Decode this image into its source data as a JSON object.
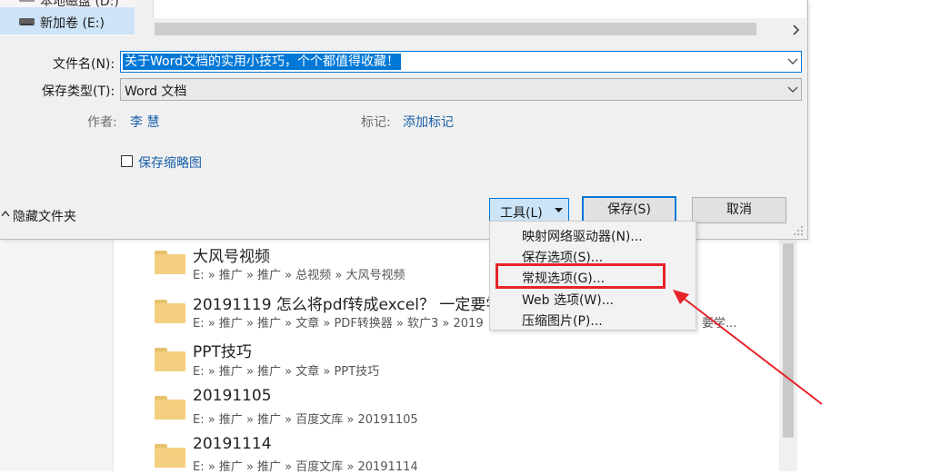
{
  "background": {
    "results": [
      {
        "title": "大风号视频",
        "path": "E: » 推广 » 推广 » 总视频 » 大风号视频"
      },
      {
        "title": "20191119 怎么将pdf转成excel？ 一定要学",
        "path": "E: » 推广 » 推广 » 文章 » PDF转换器 » 软广3 » 2019",
        "path_tail": "要学..."
      },
      {
        "title": "PPT技巧",
        "path": "E: » 推广 » 推广 » 文章 » PPT技巧"
      },
      {
        "title": "20191105",
        "path": "E: » 推广 » 推广 » 百度文库 » 20191105"
      },
      {
        "title": "20191114",
        "path": "E: » 推广 » 推广 » 百度文库 » 20191114"
      }
    ]
  },
  "dialog": {
    "nav": {
      "partial_item": "本地磁盘 (D:)",
      "selected_item": "新加卷 (E:)"
    },
    "filename_label": "文件名(N):",
    "filename_value": "关于Word文档的实用小技巧，个个都值得收藏！",
    "savetype_label": "保存类型(T):",
    "savetype_value": "Word 文档",
    "author_label": "作者:",
    "author_value": "李 慧",
    "tags_label": "标记:",
    "tags_value": "添加标记",
    "thumbnail_label": "保存缩略图",
    "hide_folders_label": "隐藏文件夹",
    "tools_label": "工具(L)",
    "save_label": "保存(S)",
    "cancel_label": "取消"
  },
  "tools_menu": {
    "items": [
      "映射网络驱动器(N)...",
      "保存选项(S)...",
      "常规选项(G)...",
      "Web 选项(W)...",
      "压缩图片(P)..."
    ],
    "highlighted": "常规选项(G)..."
  },
  "colors": {
    "accent": "#0078d7",
    "selection": "#cde3f7",
    "annotation": "#e8232a",
    "folder": "#f4cf7f",
    "link": "#1a5fa8"
  }
}
